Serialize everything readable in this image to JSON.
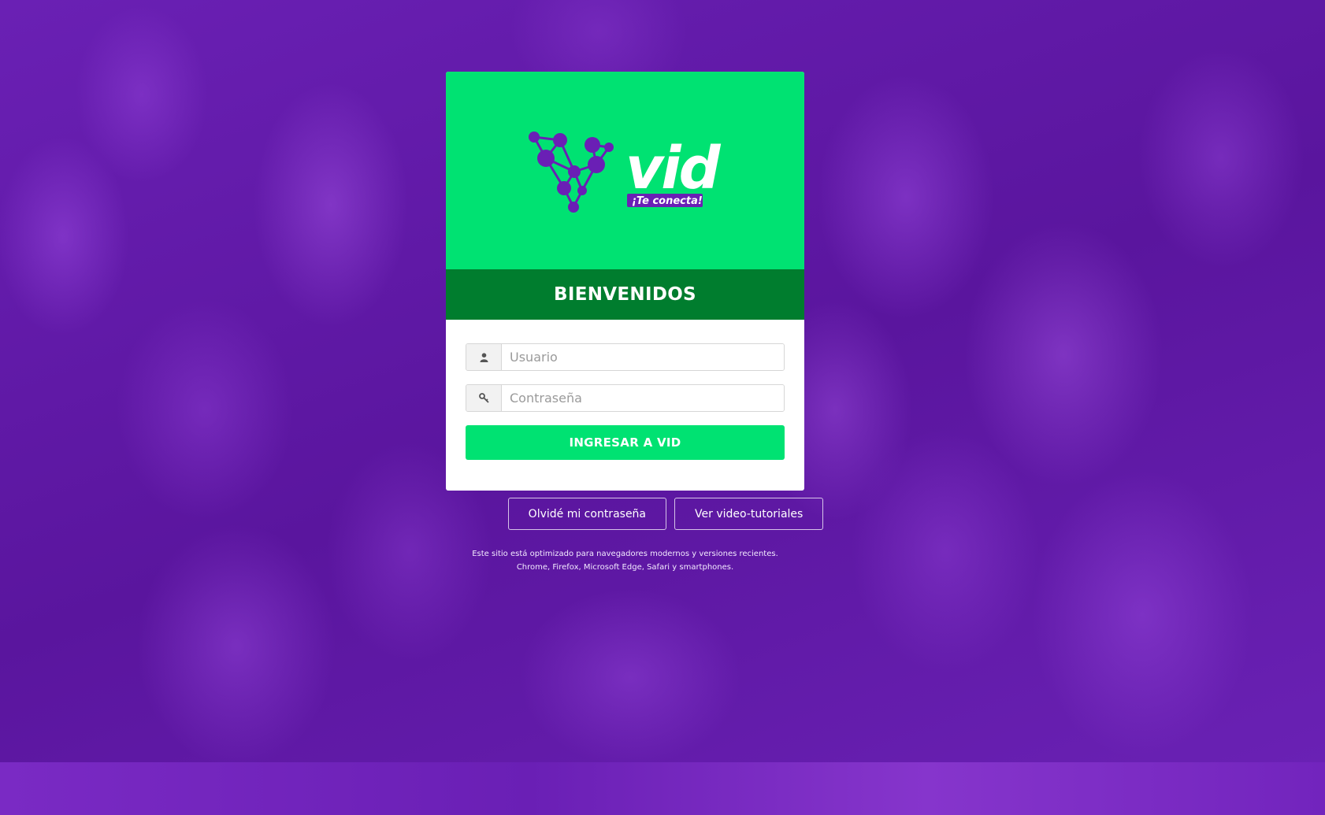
{
  "brand": {
    "logo_word": "vid",
    "logo_tagline": "¡Te conecta!",
    "icon": "molecule-v-logo-icon",
    "colors": {
      "primary_green": "#00e272",
      "dark_green": "#007d2e",
      "purple": "#6a1fb5",
      "background_purple": "#5a159e"
    }
  },
  "header": {
    "title": "BIENVENIDOS"
  },
  "form": {
    "username": {
      "placeholder": "Usuario",
      "value": "",
      "icon": "user-icon"
    },
    "password": {
      "placeholder": "Contraseña",
      "value": "",
      "icon": "key-icon"
    },
    "submit_label": "INGRESAR A VID"
  },
  "links": {
    "forgot_password": "Olvidé mi contraseña",
    "video_tutorials": "Ver video-tutoriales"
  },
  "notice": {
    "line1": "Este sitio está optimizado para navegadores modernos y versiones recientes.",
    "line2": "Chrome, Firefox, Microsoft Edge, Safari y smartphones."
  }
}
